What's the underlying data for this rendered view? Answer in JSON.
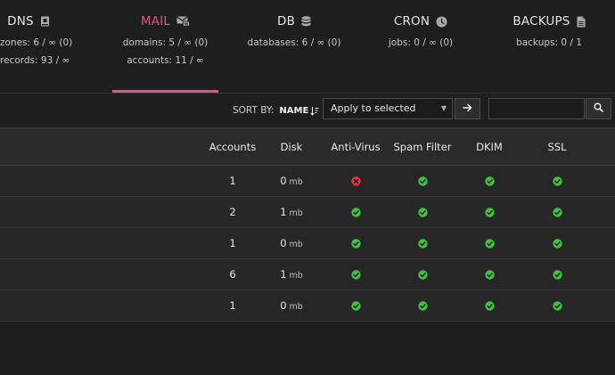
{
  "nav": [
    {
      "title": "DNS",
      "icon": "book-icon",
      "stats": [
        "zones: 6 / ∞ (0)",
        "records: 93 / ∞"
      ],
      "active": false
    },
    {
      "title": "MAIL",
      "icon": "mail-stack-icon",
      "stats": [
        "domains: 5 / ∞ (0)",
        "accounts: 11 / ∞"
      ],
      "active": true
    },
    {
      "title": "DB",
      "icon": "database-icon",
      "stats": [
        "databases: 6 / ∞ (0)"
      ],
      "active": false
    },
    {
      "title": "CRON",
      "icon": "clock-icon",
      "stats": [
        "jobs: 0 / ∞ (0)"
      ],
      "active": false
    },
    {
      "title": "BACKUPS",
      "icon": "file-icon",
      "stats": [
        "backups: 0 / 1"
      ],
      "active": false
    }
  ],
  "toolbar": {
    "sort_label": "SORT BY:",
    "sort_value": "NAME",
    "bulk_action": "Apply to selected",
    "search_placeholder": ""
  },
  "table": {
    "headers": [
      "Accounts",
      "Disk",
      "Anti-Virus",
      "Spam Filter",
      "DKIM",
      "SSL"
    ],
    "disk_unit": "mb",
    "rows": [
      {
        "accounts": "1",
        "disk": "0",
        "antivirus": false,
        "spam": true,
        "dkim": true,
        "ssl": true
      },
      {
        "accounts": "2",
        "disk": "1",
        "antivirus": true,
        "spam": true,
        "dkim": true,
        "ssl": true
      },
      {
        "accounts": "1",
        "disk": "0",
        "antivirus": true,
        "spam": true,
        "dkim": true,
        "ssl": true
      },
      {
        "accounts": "6",
        "disk": "1",
        "antivirus": true,
        "spam": true,
        "dkim": true,
        "ssl": true
      },
      {
        "accounts": "1",
        "disk": "0",
        "antivirus": true,
        "spam": true,
        "dkim": true,
        "ssl": true
      }
    ]
  },
  "colors": {
    "accent": "#e94f8a",
    "ok": "#3fc23f",
    "error": "#e0313f"
  }
}
